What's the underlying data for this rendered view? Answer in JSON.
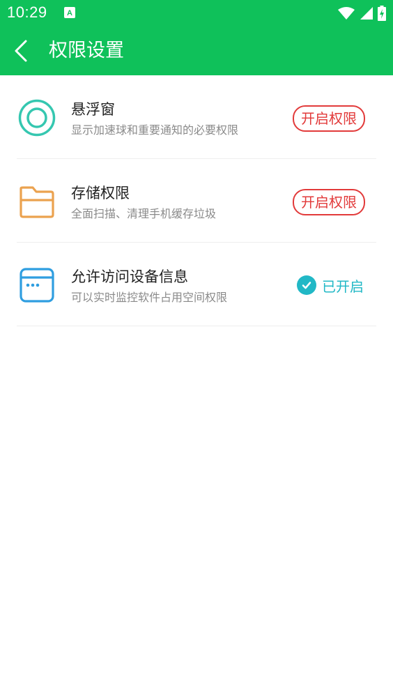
{
  "status_bar": {
    "time": "10:29",
    "icons": [
      "app-notification-icon",
      "wifi-icon",
      "signal-icon",
      "battery-charging-icon"
    ]
  },
  "header": {
    "title": "权限设置",
    "back_icon": "back-arrow-icon"
  },
  "permissions": [
    {
      "icon": "floating-window-ring-icon",
      "title": "悬浮窗",
      "subtitle": "显示加速球和重要通知的必要权限",
      "action_label": "开启权限",
      "enabled": false
    },
    {
      "icon": "folder-icon",
      "title": "存储权限",
      "subtitle": "全面扫描、清理手机缓存垃圾",
      "action_label": "开启权限",
      "enabled": false
    },
    {
      "icon": "device-window-icon",
      "title": "允许访问设备信息",
      "subtitle": "可以实时监控软件占用空间权限",
      "status_label": "已开启",
      "enabled": true
    }
  ],
  "colors": {
    "primary_green": "#0fc15a",
    "action_red": "#e23a3a",
    "enabled_teal": "#21b8c6",
    "ring_teal": "#35c7b0",
    "folder_orange": "#eba24f",
    "device_blue": "#2f9ee0"
  }
}
